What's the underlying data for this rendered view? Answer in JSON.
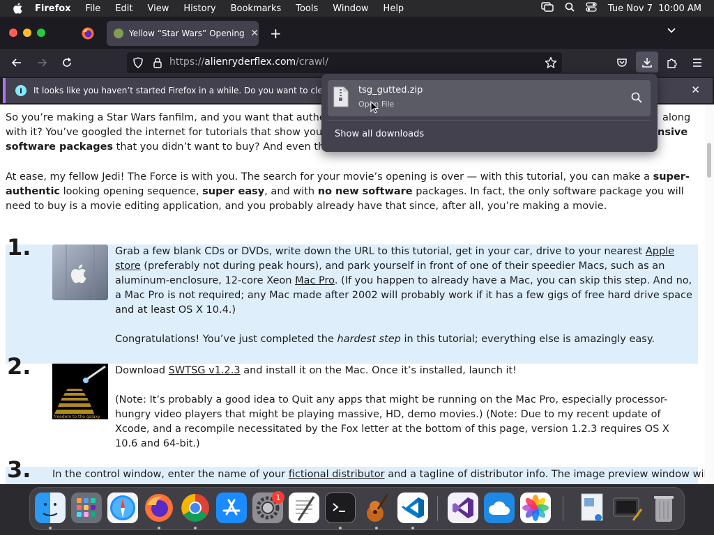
{
  "menubar": {
    "app": "Firefox",
    "items": [
      "File",
      "Edit",
      "View",
      "History",
      "Bookmarks",
      "Tools",
      "Window",
      "Help"
    ],
    "datetime": "Tue Nov 7  10:00 AM"
  },
  "tab": {
    "title": "Yellow “Star Wars” Opening Text",
    "close": "✕"
  },
  "newtab_label": "+",
  "url": {
    "full": "https://alienryderflex.com/crawl/",
    "scheme": "https://",
    "host": "alienryderflex.com",
    "path": "/crawl/"
  },
  "notice": {
    "icon": "i",
    "text": "It looks like you haven’t started Firefox in a while. Do you want to clean it up for",
    "close": "✕"
  },
  "downloads": {
    "filename": "tsg_gutted.zip",
    "status": "Open File",
    "show_all": "Show all downloads"
  },
  "content": {
    "intro1_a": "So you’re making a Star Wars fanfilm, and you want that authentic",
    "intro1_tail1": "along",
    "intro1_b": "with it? You’ve googled the internet for tutorials that show you how",
    "intro1_bold_tail": "nsive",
    "intro1_c_bold": "software packages",
    "intro1_c": " that you didn’t want to buy? And even then th",
    "intro2_a": "At ease, my fellow Jedi! The Force is with you. The search for your movie’s opening is over — with this tutorial, you can make a ",
    "intro2_b1": "super-authentic",
    "intro2_c": " looking opening sequence, ",
    "intro2_b2": "super easy",
    "intro2_d": ", and with ",
    "intro2_b3": "no new software",
    "intro2_e": " packages. In fact, the only software package you will need to buy is a movie editing application, and you probably already have that since, after all, you’re making a movie.",
    "step1": {
      "num": "1.",
      "a": "Grab a few blank CDs or DVDs, write down the URL to this tutorial, get in your car, drive to your nearest ",
      "link1": "Apple store",
      "b": " (preferably not during peak hours), and park yourself in front of one of their speedier Macs, such as an aluminum-enclosure, 12-core Xeon ",
      "link2": "Mac Pro",
      "c": ". (If you happen to already have a Mac, you can skip this step. And no, a Mac Pro is not required; any Mac made after 2002 will probably work if it has a few gigs of free hard drive space and at least OS X 10.4.)",
      "d": "Congratulations! You’ve just completed the ",
      "d_em": "hardest step",
      "e": " in this tutorial; everything else is amazingly easy."
    },
    "step2": {
      "num": "2.",
      "a": "Download ",
      "link": "SWTSG v1.2.3",
      "b": " and install it on the Mac. Once it’s installed, launch it!",
      "c": "(Note: It’s probably a good idea to Quit any apps that might be running on the Mac Pro, especially processor-hungry video players that might be playing massive, HD, demo movies.) (Note: Due to my recent update of Xcode, and a recompile necessitated by the Fox letter at the bottom of this page, version 1.2.3 requires OS X 10.6 and 64-bit.)"
    },
    "step3": {
      "num": "3.",
      "a": "In the control window, enter the name of your ",
      "link": "fictional distributor",
      "b": " and a tagline of distributor info. The image preview window will show"
    },
    "crawl_image_text": "freedom to the galaxy"
  },
  "dock": {
    "badge": "1",
    "apps": [
      "finder-icon",
      "launchpad-icon",
      "safari-icon",
      "firefox-icon",
      "chrome-icon",
      "app-store-icon",
      "system-settings-icon",
      "textedit-icon",
      "terminal-icon",
      "garageband-icon",
      "vscode-icon",
      "visual-studio-icon",
      "icloud-icon",
      "photos-icon",
      "preview-icon",
      "screenshot-icon",
      "trash-icon"
    ]
  },
  "colors": {
    "accent": "#b072ff",
    "step_highlight": "#deeefb",
    "panel": "#42414d"
  }
}
